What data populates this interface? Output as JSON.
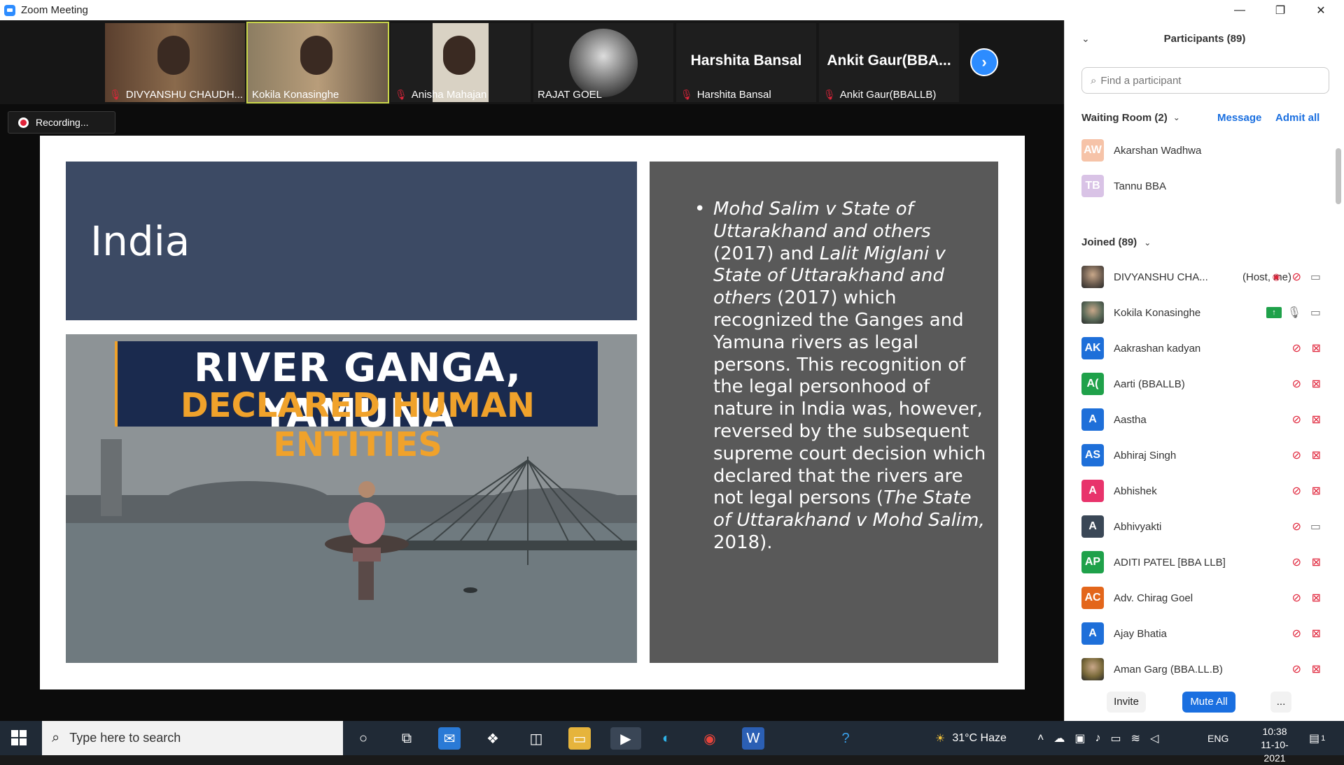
{
  "window": {
    "title": "Zoom Meeting",
    "minimize": "—",
    "restore": "❐",
    "close": "✕"
  },
  "thumbnails": [
    {
      "name": "DIVYANSHU CHAUDH...",
      "muted": true,
      "type": "video"
    },
    {
      "name": "Kokila Konasinghe",
      "muted": false,
      "type": "video",
      "active": true
    },
    {
      "name": "Anisha Mahajan",
      "muted": true,
      "type": "video"
    },
    {
      "name": "RAJAT GOEL",
      "muted": false,
      "type": "photo"
    },
    {
      "name": "Harshita Bansal",
      "muted": true,
      "type": "text",
      "display": "Harshita Bansal"
    },
    {
      "name": "Ankit Gaur(BBALLB)",
      "muted": true,
      "type": "text",
      "display": "Ankit  Gaur(BBA..."
    }
  ],
  "recording": {
    "label": "Recording..."
  },
  "slide": {
    "title": "India",
    "banner_line1": "RIVER GANGA, YAMUNA",
    "banner_line2": "DECLARED HUMAN ENTITIES",
    "bullet": "•",
    "text_parts": [
      {
        "t": "Mohd Salim v State of Uttarakhand and others",
        "i": true
      },
      {
        "t": " (2017) and ",
        "i": false
      },
      {
        "t": "Lalit Miglani v State of Uttarakhand and others",
        "i": true
      },
      {
        "t": " (2017) which recognized the Ganges and Yamuna rivers as legal persons. This recognition of the legal personhood of nature in India was, however, reversed by the subsequent supreme court decision which declared that the rivers are not legal persons (",
        "i": false
      },
      {
        "t": "The State of Uttarakhand v Mohd Salim,",
        "i": true
      },
      {
        "t": " 2018).",
        "i": false
      }
    ]
  },
  "participants_panel": {
    "title": "Participants (89)",
    "search_placeholder": "Find a participant",
    "waiting_room_label": "Waiting Room (2)",
    "message_label": "Message",
    "admit_all_label": "Admit all",
    "waiting": [
      {
        "initials": "AW",
        "name": "Akarshan Wadhwa",
        "color": "#f6c3a8"
      },
      {
        "initials": "TB",
        "name": "Tannu BBA",
        "color": "#d9c3e6"
      }
    ],
    "joined_label": "Joined (89)",
    "joined": [
      {
        "initials": "",
        "name": "DIVYANSHU CHA...",
        "role": "(Host, me)",
        "color": "#6b5b4e",
        "photo": true,
        "rec": true,
        "mic": "muted",
        "cam": "on"
      },
      {
        "initials": "",
        "name": "Kokila Konasinghe",
        "role": "",
        "color": "#5a6a58",
        "photo": true,
        "share": true,
        "mic": "on",
        "cam": "on"
      },
      {
        "initials": "AK",
        "name": "Aakrashan kadyan",
        "color": "#1e6fd9",
        "mic": "muted",
        "cam": "off"
      },
      {
        "initials": "A(",
        "name": "Aarti (BBALLB)",
        "color": "#1fa14a",
        "mic": "muted",
        "cam": "off"
      },
      {
        "initials": "A",
        "name": "Aastha",
        "color": "#1e6fd9",
        "mic": "muted",
        "cam": "off"
      },
      {
        "initials": "AS",
        "name": "Abhiraj Singh",
        "color": "#1e6fd9",
        "mic": "muted",
        "cam": "off"
      },
      {
        "initials": "A",
        "name": "Abhishek",
        "color": "#e8336b",
        "mic": "muted",
        "cam": "off"
      },
      {
        "initials": "A",
        "name": "Abhivyakti",
        "color": "#3a4756",
        "mic": "muted",
        "cam": "on"
      },
      {
        "initials": "AP",
        "name": "ADITI PATEL [BBA LLB]",
        "color": "#1fa14a",
        "mic": "muted",
        "cam": "off"
      },
      {
        "initials": "AC",
        "name": "Adv. Chirag Goel",
        "color": "#e3661b",
        "mic": "muted",
        "cam": "off"
      },
      {
        "initials": "A",
        "name": "Ajay Bhatia",
        "color": "#1e6fd9",
        "mic": "muted",
        "cam": "off"
      },
      {
        "initials": "",
        "name": "Aman Garg (BBA.LL.B)",
        "color": "#7a6a3a",
        "photo": true,
        "mic": "muted",
        "cam": "off"
      }
    ],
    "invite_label": "Invite",
    "mute_all_label": "Mute All",
    "more_label": "..."
  },
  "taskbar": {
    "search_placeholder": "Type here to search",
    "weather": "31°C  Haze",
    "language": "ENG",
    "time": "10:38",
    "date": "11-10-2021",
    "notifications": "1"
  }
}
